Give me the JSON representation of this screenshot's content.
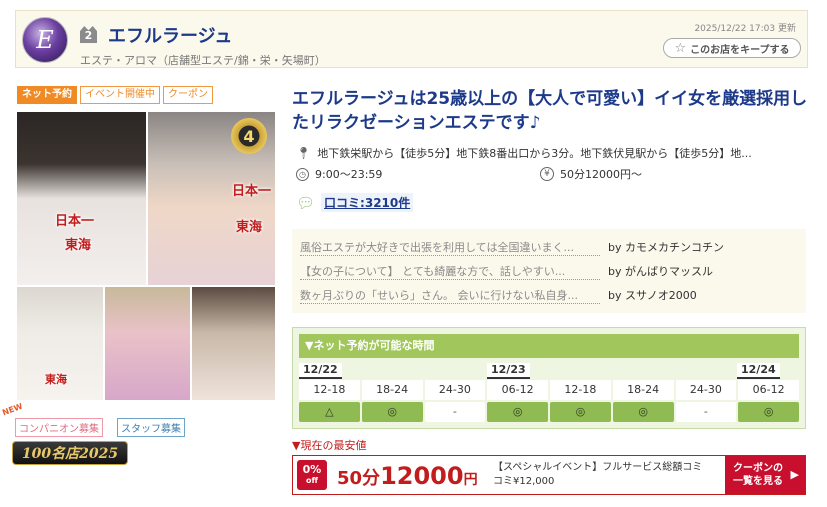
{
  "header": {
    "rank": "2",
    "shop_name": "エフルラージュ",
    "category": "エステ・アロマ（店舗型エステ/錦・栄・矢場町）",
    "updated": "2025/12/22 17:03 更新",
    "keep_label": "このお店をキープする"
  },
  "tags": [
    "ネット予約",
    "イベント開催中",
    "クーポン"
  ],
  "photo_labels": {
    "ph1_a": "日本一",
    "ph1_b": "東海",
    "ph2_a": "日本一",
    "ph2_b": "東海",
    "ph2_crown": "4",
    "ph3": "東海"
  },
  "recruit": {
    "new": "NEW",
    "companion": "コンパニオン募集",
    "staff": "スタッフ募集"
  },
  "award": "100名店2025",
  "headline": "エフルラージュは25歳以上の【大人で可愛い】イイ女を厳選採用したリラクゼーションエステです♪",
  "info": {
    "access": "地下鉄栄駅から【徒歩5分】地下鉄8番出口から3分。地下鉄伏見駅から【徒歩5分】地...",
    "hours": "9:00～23:59",
    "price": "50分12000円～",
    "reviews_link": "口コミ:3210件"
  },
  "reviews": [
    {
      "text": "風俗エステが大好きで出張を利用しては全国違いまく...",
      "by": "by カモメカチンコチン"
    },
    {
      "text": "【女の子について】 とても綺麗な方で、話しやすい...",
      "by": "by がんばりマッスル"
    },
    {
      "text": "数ヶ月ぶりの「せいら」さん。 会いに行けない私自身...",
      "by": "by スサノオ2000"
    }
  ],
  "schedule": {
    "title": "▼ネット予約が可能な時間",
    "dates": [
      "12/22",
      "12/23",
      "12/24"
    ],
    "slots": [
      {
        "time": "12-18",
        "mark": "△"
      },
      {
        "time": "18-24",
        "mark": "◎"
      },
      {
        "time": "24-30",
        "mark": "-"
      },
      {
        "time": "06-12",
        "mark": "◎"
      },
      {
        "time": "12-18",
        "mark": "◎"
      },
      {
        "time": "18-24",
        "mark": "◎"
      },
      {
        "time": "24-30",
        "mark": "-"
      },
      {
        "time": "06-12",
        "mark": "◎"
      }
    ]
  },
  "lowest": {
    "label": "▼現在の最安値",
    "off_pct": "0%",
    "off_word": "off",
    "minutes": "50分",
    "price": "12000",
    "yen": "円",
    "desc": "【スペシャルイベント】フルサービス総額コミコミ¥12,000",
    "btn_line1": "クーポンの",
    "btn_line2": "一覧を見る",
    "btn_arrow": "▶"
  }
}
